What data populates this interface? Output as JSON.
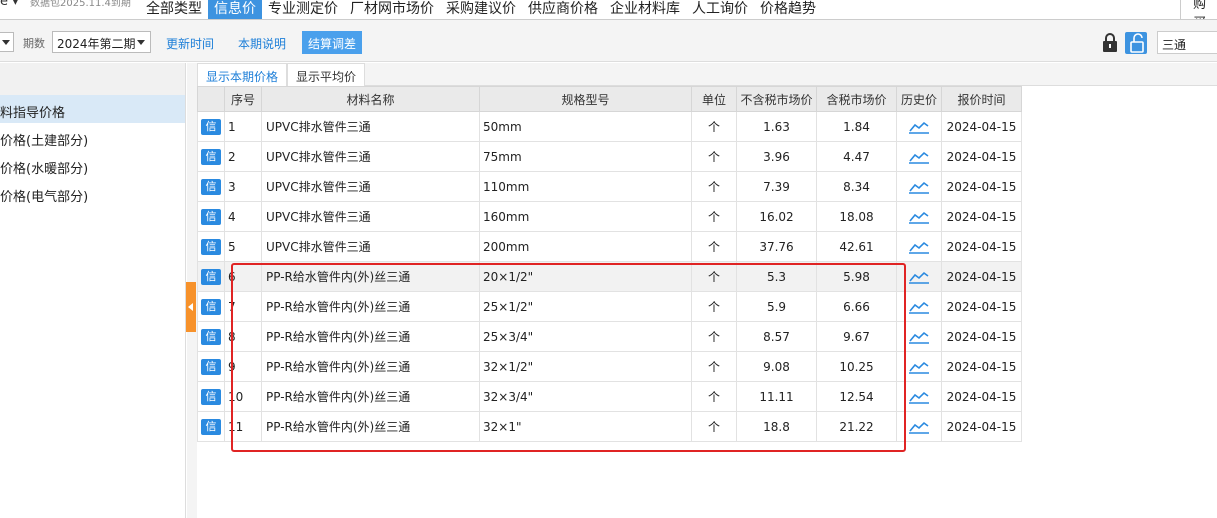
{
  "topbar": {
    "left_stub": "е ▾",
    "package_text": "数据包2025.11.4到期",
    "nav": [
      "全部类型",
      "信息价",
      "专业测定价",
      "厂材网市场价",
      "采购建议价",
      "供应商价格",
      "企业材料库",
      "人工询价",
      "价格趋势"
    ],
    "active_nav": "信息价",
    "right_stub": "购买"
  },
  "toolbar": {
    "period_label": "期数",
    "period_value": "2024年第二期",
    "update_time": "更新时间",
    "period_note": "本期说明",
    "settle": "结算调差",
    "search_value": "三通"
  },
  "sidebar": {
    "items": [
      "料指导价格",
      "价格(土建部分)",
      "价格(水暖部分)",
      "价格(电气部分)"
    ],
    "selected_index": 0
  },
  "tabs": [
    "显示本期价格",
    "显示平均价"
  ],
  "table": {
    "columns": [
      "",
      "序号",
      "材料名称",
      "规格型号",
      "单位",
      "不含税市场价",
      "含税市场价",
      "历史价",
      "报价时间"
    ],
    "xin_label": "信",
    "rows": [
      {
        "no": "1",
        "name": "UPVC排水管件三通",
        "spec": "50mm",
        "unit": "个",
        "p1": "1.63",
        "p2": "1.84",
        "date": "2024-04-15"
      },
      {
        "no": "2",
        "name": "UPVC排水管件三通",
        "spec": "75mm",
        "unit": "个",
        "p1": "3.96",
        "p2": "4.47",
        "date": "2024-04-15"
      },
      {
        "no": "3",
        "name": "UPVC排水管件三通",
        "spec": "110mm",
        "unit": "个",
        "p1": "7.39",
        "p2": "8.34",
        "date": "2024-04-15"
      },
      {
        "no": "4",
        "name": "UPVC排水管件三通",
        "spec": "160mm",
        "unit": "个",
        "p1": "16.02",
        "p2": "18.08",
        "date": "2024-04-15"
      },
      {
        "no": "5",
        "name": "UPVC排水管件三通",
        "spec": "200mm",
        "unit": "个",
        "p1": "37.76",
        "p2": "42.61",
        "date": "2024-04-15"
      },
      {
        "no": "6",
        "name": "PP-R给水管件内(外)丝三通",
        "spec": "20×1/2\"",
        "unit": "个",
        "p1": "5.3",
        "p2": "5.98",
        "date": "2024-04-15"
      },
      {
        "no": "7",
        "name": "PP-R给水管件内(外)丝三通",
        "spec": "25×1/2\"",
        "unit": "个",
        "p1": "5.9",
        "p2": "6.66",
        "date": "2024-04-15"
      },
      {
        "no": "8",
        "name": "PP-R给水管件内(外)丝三通",
        "spec": "25×3/4\"",
        "unit": "个",
        "p1": "8.57",
        "p2": "9.67",
        "date": "2024-04-15"
      },
      {
        "no": "9",
        "name": "PP-R给水管件内(外)丝三通",
        "spec": "32×1/2\"",
        "unit": "个",
        "p1": "9.08",
        "p2": "10.25",
        "date": "2024-04-15"
      },
      {
        "no": "10",
        "name": "PP-R给水管件内(外)丝三通",
        "spec": "32×3/4\"",
        "unit": "个",
        "p1": "11.11",
        "p2": "12.54",
        "date": "2024-04-15"
      },
      {
        "no": "11",
        "name": "PP-R给水管件内(外)丝三通",
        "spec": "32×1\"",
        "unit": "个",
        "p1": "18.8",
        "p2": "21.22",
        "date": "2024-04-15"
      }
    ],
    "highlighted_row": 5
  },
  "colors": {
    "accent": "#3d93e0",
    "xin": "#2a8ae0",
    "annotation": "#e02424",
    "collapse": "#f7922b"
  }
}
